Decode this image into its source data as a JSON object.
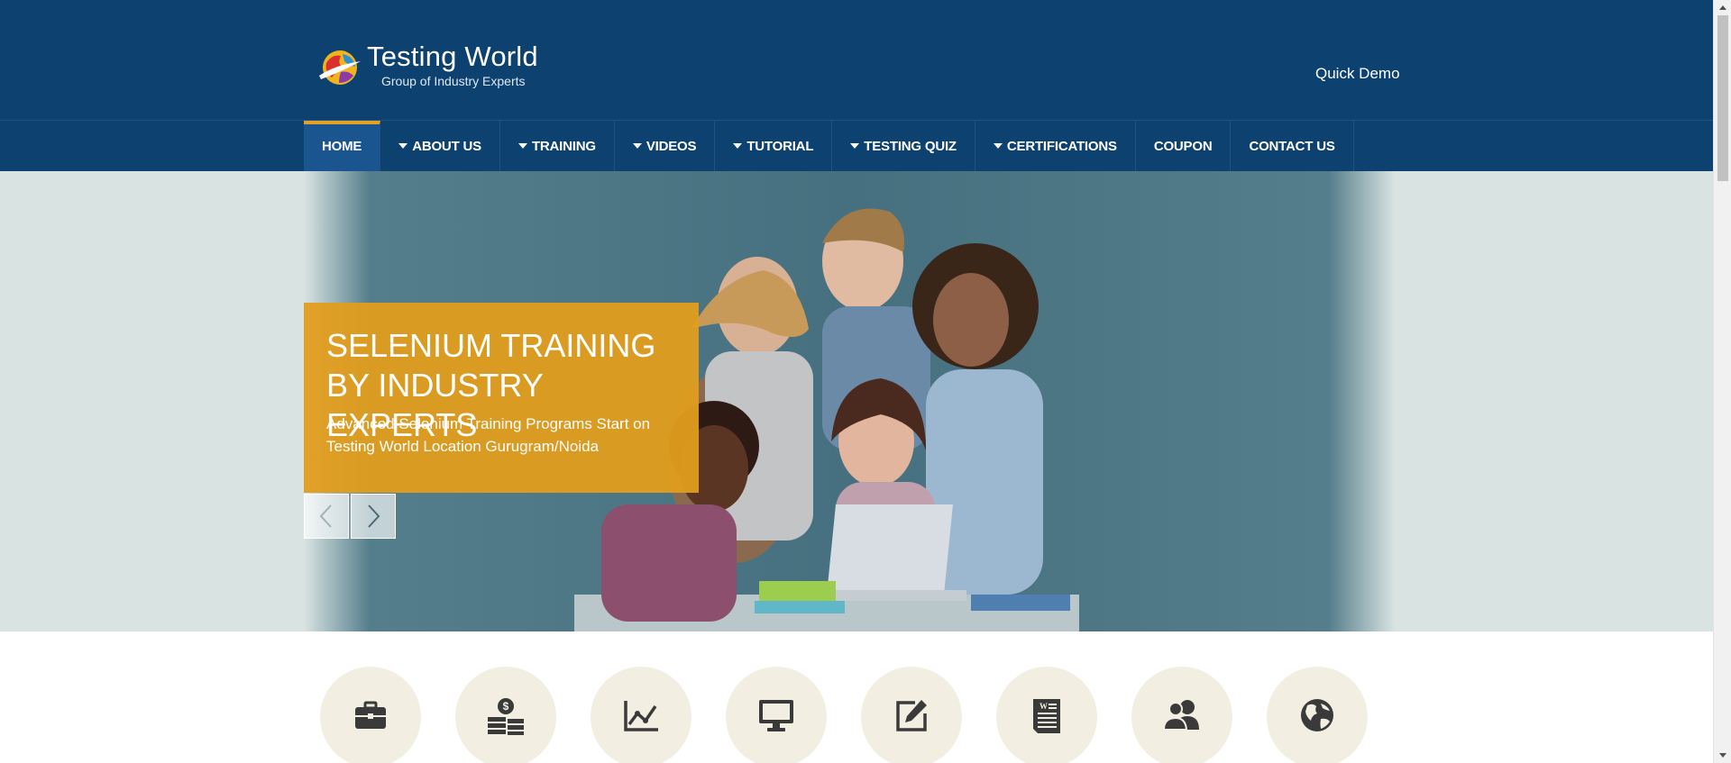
{
  "header": {
    "logo_title": "Testing World",
    "logo_tagline": "Group of Industry Experts",
    "quick_demo": "Quick Demo"
  },
  "nav": {
    "items": [
      {
        "label": "HOME",
        "active": true,
        "dropdown": false
      },
      {
        "label": "ABOUT US",
        "active": false,
        "dropdown": true
      },
      {
        "label": "TRAINING",
        "active": false,
        "dropdown": true
      },
      {
        "label": "VIDEOS",
        "active": false,
        "dropdown": true
      },
      {
        "label": "TUTORIAL",
        "active": false,
        "dropdown": true
      },
      {
        "label": "TESTING QUIZ",
        "active": false,
        "dropdown": true
      },
      {
        "label": "CERTIFICATIONS",
        "active": false,
        "dropdown": true
      },
      {
        "label": "COUPON",
        "active": false,
        "dropdown": false
      },
      {
        "label": "CONTACT US",
        "active": false,
        "dropdown": false
      }
    ]
  },
  "hero": {
    "title_line1": "SELENIUM TRAINING",
    "title_line2": "BY INDUSTRY EXPERTS",
    "subtitle_line1": "Advanced Selenium Training Programs Start on",
    "subtitle_line2": "Testing World Location Gurugram/Noida",
    "prev_icon": "chevron-left-icon",
    "next_icon": "chevron-right-icon"
  },
  "features": {
    "icons": [
      "briefcase-icon",
      "money-icon",
      "line-chart-icon",
      "monitor-icon",
      "edit-icon",
      "word-document-icon",
      "users-icon",
      "globe-icon"
    ]
  },
  "colors": {
    "header_bg": "#0d4170",
    "nav_active_bg": "#1a5590",
    "accent": "#e5a124",
    "caption_bg": "#e29d1e",
    "hero_bg": "#d9e3e2",
    "feature_circle": "#f2efe2",
    "feature_icon": "#3a3a3a"
  }
}
